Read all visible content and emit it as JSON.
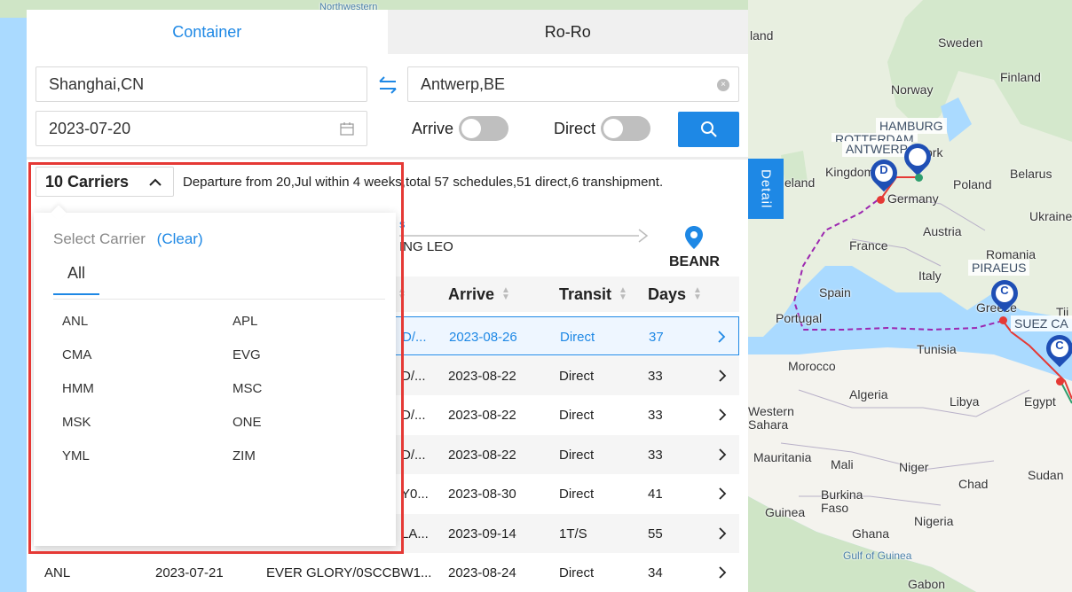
{
  "tabs": {
    "container": "Container",
    "roro": "Ro-Ro"
  },
  "search": {
    "origin": "Shanghai,CN",
    "destination": "Antwerp,BE",
    "date": "2023-07-20",
    "arrive_label": "Arrive",
    "direct_label": "Direct"
  },
  "carriers": {
    "button_label": "10 Carriers",
    "select_label": "Select Carrier",
    "clear_label": "(Clear)",
    "all_label": "All",
    "items": [
      "ANL",
      "APL",
      "CMA",
      "EVG",
      "HMM",
      "MSC",
      "MSK",
      "ONE",
      "YML",
      "ZIM"
    ]
  },
  "summary": "Departure from 20,Jul within 4 weeks,total 57 schedules,51 direct,6 transhipment.",
  "route": {
    "top_text": "s",
    "vessel": "ING LEO",
    "pod": "BEANR"
  },
  "table": {
    "headers": {
      "arrive": "Arrive",
      "transit": "Transit",
      "days": "Days"
    },
    "rows": [
      {
        "vessel": "D/...",
        "arrive": "2023-08-26",
        "transit": "Direct",
        "days": "37"
      },
      {
        "vessel": "D/...",
        "arrive": "2023-08-22",
        "transit": "Direct",
        "days": "33"
      },
      {
        "vessel": "D/...",
        "arrive": "2023-08-22",
        "transit": "Direct",
        "days": "33"
      },
      {
        "vessel": "D/...",
        "arrive": "2023-08-22",
        "transit": "Direct",
        "days": "33"
      },
      {
        "vessel": "Y0...",
        "arrive": "2023-08-30",
        "transit": "Direct",
        "days": "41"
      },
      {
        "vessel": "LA...",
        "arrive": "2023-09-14",
        "transit": "1T/S",
        "days": "55"
      }
    ],
    "last_row": {
      "carrier": "ANL",
      "depart": "2023-07-21",
      "vessel": "EVER GLORY/0SCCBW1...",
      "arrive": "2023-08-24",
      "transit": "Direct",
      "days": "34"
    }
  },
  "detail_tab": "Detail",
  "map": {
    "labels": {
      "northwestern": "Northwestern",
      "land": "land",
      "sweden": "Sweden",
      "finland": "Finland",
      "norway": "Norway",
      "kingdom": "Kingdom",
      "ireland": "eland",
      "germany": "Germany",
      "poland": "Poland",
      "belarus": "Belarus",
      "ukraine": "Ukraine",
      "france": "France",
      "austria": "Austria",
      "romania": "Romania",
      "spain": "Spain",
      "italy": "Italy",
      "portugal": "Portugal",
      "greece": "Greece",
      "tii": "Tii",
      "tunisia": "Tunisia",
      "morocco": "Morocco",
      "algeria": "Algeria",
      "libya": "Libya",
      "egypt": "Egypt",
      "western_sahara": "Western\nSahara",
      "mauritania": "Mauritania",
      "mali": "Mali",
      "niger": "Niger",
      "chad": "Chad",
      "sudan": "Sudan",
      "burkina_faso": "Burkina\nFaso",
      "guinea": "Guinea",
      "ghana": "Ghana",
      "nigeria": "Nigeria",
      "gulf_of_guinea": "Gulf of Guinea",
      "gabon": "Gabon",
      "york": "ork"
    },
    "ports": {
      "hamburg": "HAMBURG",
      "rotterdam": "ROTTERDAM",
      "antwerp": "ANTWERP",
      "piraeus": "PIRAEUS",
      "suez": "SUEZ CA"
    },
    "markers": {
      "d": "D",
      "c1": "C",
      "c2": "C"
    },
    "colors": {
      "route_dashed": "#9c27b0",
      "route_solid": "#e53935",
      "marker": "#1f4fb5",
      "land": "#f4f3ee",
      "land_green": "#cfe5c6",
      "sea": "#aadaff"
    }
  },
  "accent": "#1e88e5"
}
